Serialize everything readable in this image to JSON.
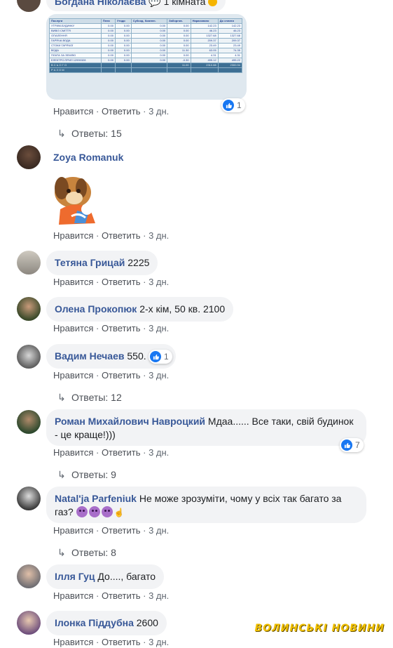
{
  "comments": [
    {
      "name": "Богдана Ніколаєва",
      "text": "1 кімната",
      "actions": {
        "like": "Нравится",
        "reply": "Ответить",
        "time": "3 дн."
      },
      "reaction_count": "1",
      "replies": "Ответы: 15"
    },
    {
      "name": "Zoya Romanuk",
      "text": "",
      "actions": {
        "like": "Нравится",
        "reply": "Ответить",
        "time": "3 дн."
      }
    },
    {
      "name": "Тетяна Грицай",
      "text": "2225",
      "actions": {
        "like": "Нравится",
        "reply": "Ответить",
        "time": "3 дн."
      }
    },
    {
      "name": "Олена Прокопюк",
      "text": "2-х кім, 50 кв. 2100",
      "actions": {
        "like": "Нравится",
        "reply": "Ответить",
        "time": "3 дн."
      }
    },
    {
      "name": "Вадим Нечаев",
      "text": "550.",
      "reaction_count": "1",
      "actions": {
        "like": "Нравится",
        "reply": "Ответить",
        "time": "3 дн."
      },
      "replies": "Ответы: 12"
    },
    {
      "name": "Роман Михайлович Навроцкий",
      "text": "Мдаа...... Все таки, свій будинок - це краще!)))",
      "reaction_count": "7",
      "actions": {
        "like": "Нравится",
        "reply": "Ответить",
        "time": "3 дн."
      },
      "replies": "Ответы: 9"
    },
    {
      "name": "Natal'ja Parfeniuk",
      "text": "Не може зрозуміти, чому у всіх так багато за газ?",
      "actions": {
        "like": "Нравится",
        "reply": "Ответить",
        "time": "3 дн."
      },
      "replies": "Ответы: 8"
    },
    {
      "name": "Ілля Гуц",
      "text": "До...., багато",
      "actions": {
        "like": "Нравится",
        "reply": "Ответить",
        "time": "3 дн."
      }
    },
    {
      "name": "Ілонка Піддубна",
      "text": "2600",
      "actions": {
        "like": "Нравится",
        "reply": "Ответить",
        "time": "3 дн."
      }
    }
  ],
  "bill_table": {
    "headers": [
      "Послуги",
      "Пеня",
      "Утоди",
      "Субсид. Компен.",
      "Заборгов.",
      "Нараховано",
      "До сплати"
    ],
    "rows": [
      [
        "УТРИМ.БУДИНКУ",
        "0.00",
        "0.00",
        "0.00",
        "0.00",
        "142.23",
        "142.23"
      ],
      [
        "ВИВІЗ СМІТТЯ",
        "0.00",
        "0.00",
        "0.00",
        "0.00",
        "46.23",
        "46.23"
      ],
      [
        "ОПАЛЕННЯ",
        "0.00",
        "0.00",
        "0.00",
        "0.00",
        "1327.68",
        "1327.68"
      ],
      [
        "ГАРЯЧА ВОДА",
        "0.00",
        "0.00",
        "0.00",
        "0.00",
        "209.37",
        "209.37"
      ],
      [
        "СТОКИ ГАРЯЧОЇ",
        "0.00",
        "0.00",
        "0.00",
        "0.00",
        "23.49",
        "23.49"
      ],
      [
        "ВОДА",
        "0.00",
        "0.00",
        "0.00",
        "11.30",
        "63.05",
        "74.35"
      ],
      [
        "ПЛАТА ЗА ЗЕМЛЮ",
        "0.00",
        "0.00",
        "0.00",
        "0.00",
        "4.31",
        "4.31"
      ],
      [
        "ЕЛЕКТРО.ПРИЛ 12990328",
        "0.00",
        "0.00",
        "0.00",
        "-0.30",
        "495.12",
        "495.22"
      ],
      [
        "В С Ь О Г О",
        "",
        "",
        "",
        "11.00",
        "2310.88",
        "2300.94"
      ],
      [
        "Р А З О М",
        "",
        "",
        "",
        "",
        "",
        ""
      ]
    ]
  },
  "watermark": "ВОЛИНСЬКІ НОВИНИ"
}
